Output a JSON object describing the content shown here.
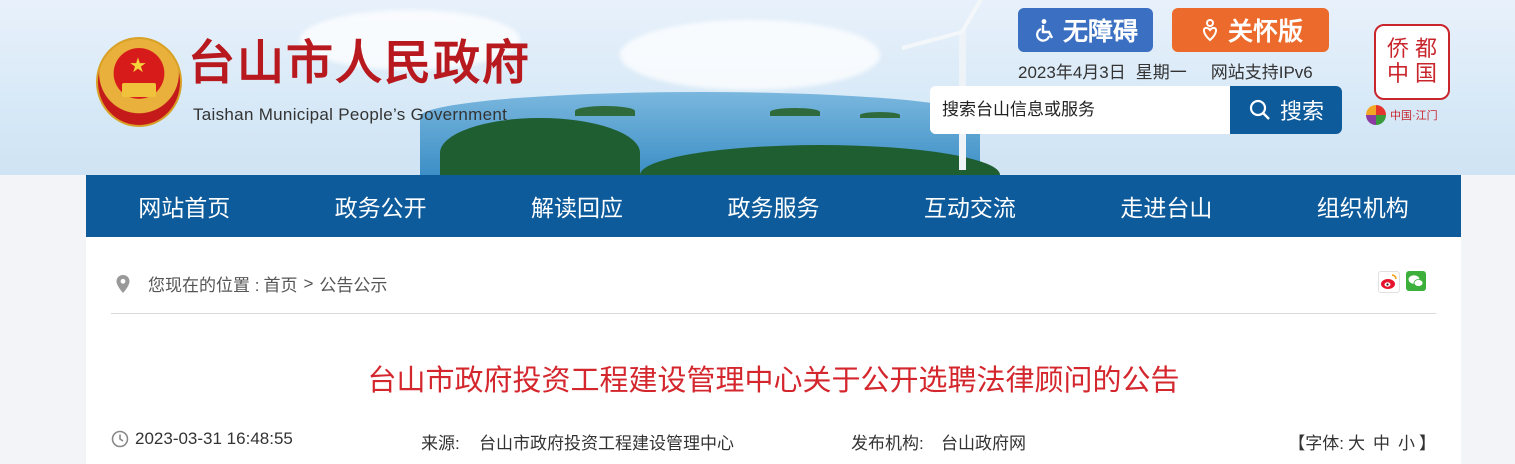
{
  "header": {
    "site_title": "台山市人民政府",
    "site_subtitle": "Taishan Municipal People’s Government",
    "accessibility_label": "无障碍",
    "care_mode_label": "关怀版",
    "date": "2023年4月3日",
    "weekday": "星期一",
    "ipv6": "网站支持IPv6",
    "search_placeholder": "搜索台山信息或服务",
    "search_button": "搜索",
    "qiao_logo_text": "侨都中国",
    "jiangmen_logo_text": "中国·江门"
  },
  "nav": {
    "items": [
      "网站首页",
      "政务公开",
      "解读回应",
      "政务服务",
      "互动交流",
      "走进台山",
      "组织机构"
    ]
  },
  "breadcrumb": {
    "prefix": "您现在的位置 :",
    "home": "首页",
    "separator": ">",
    "current": "公告公示"
  },
  "article": {
    "title": "台山市政府投资工程建设管理中心关于公开选聘法律顾问的公告",
    "datetime": "2023-03-31 16:48:55",
    "source_label": "来源:",
    "source": "台山市政府投资工程建设管理中心",
    "publisher_label": "发布机构:",
    "publisher": "台山政府网",
    "font_open": "【字体:",
    "font_large": "大",
    "font_medium": "中",
    "font_small": "小",
    "font_close": "】"
  },
  "colors": {
    "nav_bg": "#0d5b9b",
    "title_red": "#d4262d",
    "accessibility_bg": "#3a6fc1",
    "care_bg": "#ec6b2c"
  }
}
